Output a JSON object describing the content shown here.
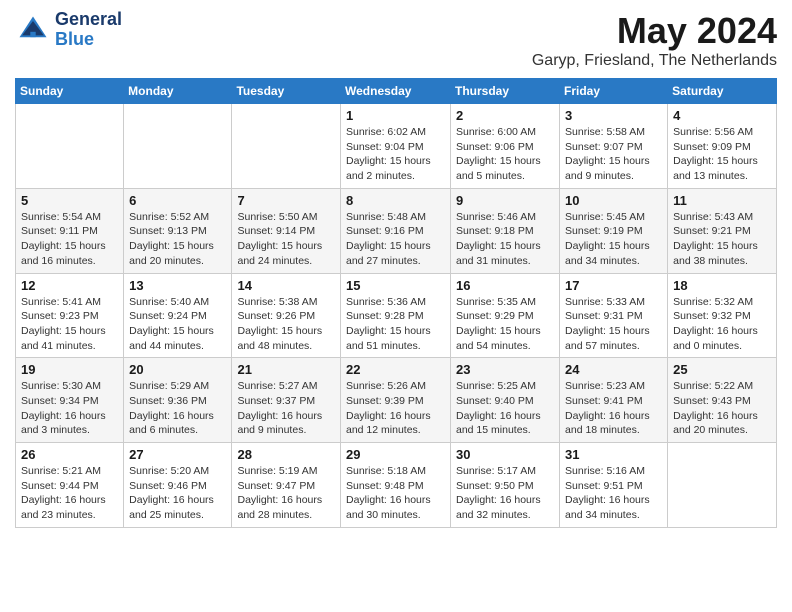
{
  "header": {
    "logo_line1": "General",
    "logo_line2": "Blue",
    "month_year": "May 2024",
    "location": "Garyp, Friesland, The Netherlands"
  },
  "days_of_week": [
    "Sunday",
    "Monday",
    "Tuesday",
    "Wednesday",
    "Thursday",
    "Friday",
    "Saturday"
  ],
  "weeks": [
    [
      {
        "day": "",
        "info": ""
      },
      {
        "day": "",
        "info": ""
      },
      {
        "day": "",
        "info": ""
      },
      {
        "day": "1",
        "info": "Sunrise: 6:02 AM\nSunset: 9:04 PM\nDaylight: 15 hours\nand 2 minutes."
      },
      {
        "day": "2",
        "info": "Sunrise: 6:00 AM\nSunset: 9:06 PM\nDaylight: 15 hours\nand 5 minutes."
      },
      {
        "day": "3",
        "info": "Sunrise: 5:58 AM\nSunset: 9:07 PM\nDaylight: 15 hours\nand 9 minutes."
      },
      {
        "day": "4",
        "info": "Sunrise: 5:56 AM\nSunset: 9:09 PM\nDaylight: 15 hours\nand 13 minutes."
      }
    ],
    [
      {
        "day": "5",
        "info": "Sunrise: 5:54 AM\nSunset: 9:11 PM\nDaylight: 15 hours\nand 16 minutes."
      },
      {
        "day": "6",
        "info": "Sunrise: 5:52 AM\nSunset: 9:13 PM\nDaylight: 15 hours\nand 20 minutes."
      },
      {
        "day": "7",
        "info": "Sunrise: 5:50 AM\nSunset: 9:14 PM\nDaylight: 15 hours\nand 24 minutes."
      },
      {
        "day": "8",
        "info": "Sunrise: 5:48 AM\nSunset: 9:16 PM\nDaylight: 15 hours\nand 27 minutes."
      },
      {
        "day": "9",
        "info": "Sunrise: 5:46 AM\nSunset: 9:18 PM\nDaylight: 15 hours\nand 31 minutes."
      },
      {
        "day": "10",
        "info": "Sunrise: 5:45 AM\nSunset: 9:19 PM\nDaylight: 15 hours\nand 34 minutes."
      },
      {
        "day": "11",
        "info": "Sunrise: 5:43 AM\nSunset: 9:21 PM\nDaylight: 15 hours\nand 38 minutes."
      }
    ],
    [
      {
        "day": "12",
        "info": "Sunrise: 5:41 AM\nSunset: 9:23 PM\nDaylight: 15 hours\nand 41 minutes."
      },
      {
        "day": "13",
        "info": "Sunrise: 5:40 AM\nSunset: 9:24 PM\nDaylight: 15 hours\nand 44 minutes."
      },
      {
        "day": "14",
        "info": "Sunrise: 5:38 AM\nSunset: 9:26 PM\nDaylight: 15 hours\nand 48 minutes."
      },
      {
        "day": "15",
        "info": "Sunrise: 5:36 AM\nSunset: 9:28 PM\nDaylight: 15 hours\nand 51 minutes."
      },
      {
        "day": "16",
        "info": "Sunrise: 5:35 AM\nSunset: 9:29 PM\nDaylight: 15 hours\nand 54 minutes."
      },
      {
        "day": "17",
        "info": "Sunrise: 5:33 AM\nSunset: 9:31 PM\nDaylight: 15 hours\nand 57 minutes."
      },
      {
        "day": "18",
        "info": "Sunrise: 5:32 AM\nSunset: 9:32 PM\nDaylight: 16 hours\nand 0 minutes."
      }
    ],
    [
      {
        "day": "19",
        "info": "Sunrise: 5:30 AM\nSunset: 9:34 PM\nDaylight: 16 hours\nand 3 minutes."
      },
      {
        "day": "20",
        "info": "Sunrise: 5:29 AM\nSunset: 9:36 PM\nDaylight: 16 hours\nand 6 minutes."
      },
      {
        "day": "21",
        "info": "Sunrise: 5:27 AM\nSunset: 9:37 PM\nDaylight: 16 hours\nand 9 minutes."
      },
      {
        "day": "22",
        "info": "Sunrise: 5:26 AM\nSunset: 9:39 PM\nDaylight: 16 hours\nand 12 minutes."
      },
      {
        "day": "23",
        "info": "Sunrise: 5:25 AM\nSunset: 9:40 PM\nDaylight: 16 hours\nand 15 minutes."
      },
      {
        "day": "24",
        "info": "Sunrise: 5:23 AM\nSunset: 9:41 PM\nDaylight: 16 hours\nand 18 minutes."
      },
      {
        "day": "25",
        "info": "Sunrise: 5:22 AM\nSunset: 9:43 PM\nDaylight: 16 hours\nand 20 minutes."
      }
    ],
    [
      {
        "day": "26",
        "info": "Sunrise: 5:21 AM\nSunset: 9:44 PM\nDaylight: 16 hours\nand 23 minutes."
      },
      {
        "day": "27",
        "info": "Sunrise: 5:20 AM\nSunset: 9:46 PM\nDaylight: 16 hours\nand 25 minutes."
      },
      {
        "day": "28",
        "info": "Sunrise: 5:19 AM\nSunset: 9:47 PM\nDaylight: 16 hours\nand 28 minutes."
      },
      {
        "day": "29",
        "info": "Sunrise: 5:18 AM\nSunset: 9:48 PM\nDaylight: 16 hours\nand 30 minutes."
      },
      {
        "day": "30",
        "info": "Sunrise: 5:17 AM\nSunset: 9:50 PM\nDaylight: 16 hours\nand 32 minutes."
      },
      {
        "day": "31",
        "info": "Sunrise: 5:16 AM\nSunset: 9:51 PM\nDaylight: 16 hours\nand 34 minutes."
      },
      {
        "day": "",
        "info": ""
      }
    ]
  ]
}
